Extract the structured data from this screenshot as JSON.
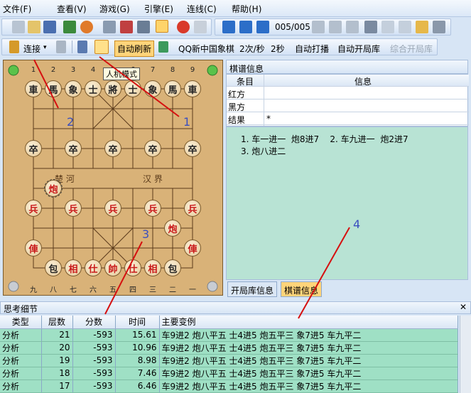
{
  "menu": [
    "文件(F)",
    "查看(V)",
    "游戏(G)",
    "引擎(E)",
    "连线(C)",
    "帮助(H)"
  ],
  "toolbar": {
    "move_counter": "005/005"
  },
  "toolbar2": {
    "connect": "连接",
    "auto_refresh": "自动刷新",
    "platform": "QQ新中国象棋",
    "rate": "2次/秒",
    "interval": "2秒",
    "auto_click": "自动打播",
    "auto_open": "自动开局库",
    "combined_open": "综合开局库"
  },
  "board": {
    "tooltip": "人机模式",
    "top_numbers": [
      "1",
      "2",
      "3",
      "4",
      "5",
      "6",
      "7",
      "8",
      "9"
    ],
    "bottom_numbers": [
      "九",
      "八",
      "七",
      "六",
      "五",
      "四",
      "三",
      "二",
      "一"
    ],
    "river_left": "楚 河",
    "river_right": "汉 界"
  },
  "panel": {
    "title": "棋谱信息",
    "col_item": "条目",
    "col_info": "信息",
    "rows": [
      {
        "k": "红方",
        "v": ""
      },
      {
        "k": "黑方",
        "v": ""
      },
      {
        "k": "结果",
        "v": "*"
      }
    ]
  },
  "moves": {
    "line1": "1. 车一进一  炮8进7    2. 车九进一  炮2进7",
    "line2": "3. 炮八进二"
  },
  "tabs": {
    "opening": "开局库信息",
    "record": "棋谱信息"
  },
  "think": {
    "title": "思考细节",
    "headers": [
      "类型",
      "层数",
      "分数",
      "时间",
      "主要变例"
    ],
    "rows": [
      [
        "分析",
        "21",
        "-593",
        "15.61",
        "车9进2 炮八平五 士4进5 炮五平三 象7进5 车九平二"
      ],
      [
        "分析",
        "20",
        "-593",
        "10.96",
        "车9进2 炮八平五 士4进5 炮五平三 象7进5 车九平二"
      ],
      [
        "分析",
        "19",
        "-593",
        "8.98",
        "车9进2 炮八平五 士4进5 炮五平三 象7进5 车九平二"
      ],
      [
        "分析",
        "18",
        "-593",
        "7.46",
        "车9进2 炮八平五 士4进5 炮五平三 象7进5 车九平二"
      ],
      [
        "分析",
        "17",
        "-593",
        "6.46",
        "车9进2 炮八平五 士4进5 炮五平三 象7进5 车九平二"
      ]
    ]
  },
  "annotations": [
    "1",
    "2",
    "3",
    "4"
  ]
}
